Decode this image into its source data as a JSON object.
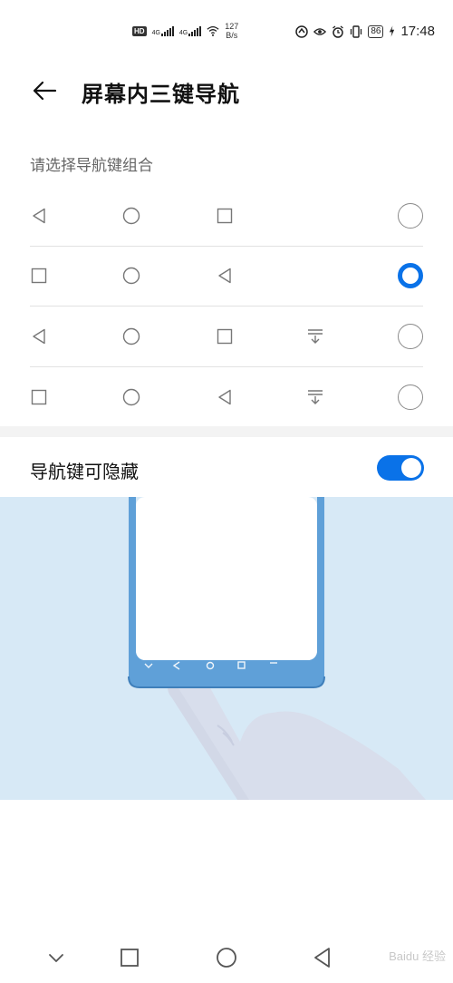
{
  "status_bar": {
    "hd_badge": "HD",
    "sim1_label": "4G",
    "sim2_label": "4G",
    "net_speed_value": "127",
    "net_speed_unit": "B/s",
    "battery_level": "86",
    "time": "17:48"
  },
  "header": {
    "title": "屏幕内三键导航"
  },
  "section": {
    "label": "请选择导航键组合"
  },
  "options": [
    {
      "keys": [
        "back-icon",
        "home-icon",
        "recents-icon"
      ],
      "selected": false
    },
    {
      "keys": [
        "recents-icon",
        "home-icon",
        "back-icon"
      ],
      "selected": true
    },
    {
      "keys": [
        "back-icon",
        "home-icon",
        "recents-icon",
        "notification-pull-icon"
      ],
      "selected": false
    },
    {
      "keys": [
        "recents-icon",
        "home-icon",
        "back-icon",
        "notification-pull-icon"
      ],
      "selected": false
    }
  ],
  "hide_toggle": {
    "label": "导航键可隐藏",
    "enabled": true
  },
  "colors": {
    "accent": "#0a72e8",
    "illustration_bg": "#d7e9f6",
    "phone_frame": "#5fa0d8"
  },
  "system_nav": [
    "hide-nav-icon",
    "recents-icon",
    "home-icon",
    "back-icon"
  ],
  "watermark": "Baidu 经验"
}
